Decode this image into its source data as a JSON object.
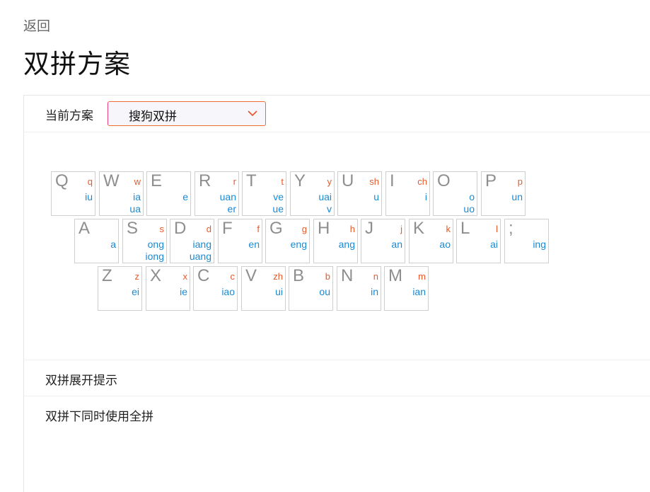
{
  "header": {
    "back_label": "返回",
    "title": "双拼方案"
  },
  "scheme": {
    "label": "当前方案",
    "selected": "搜狗双拼"
  },
  "keyboard": {
    "rows": [
      [
        {
          "letter": "Q",
          "initial": "q",
          "finals": [
            "iu"
          ]
        },
        {
          "letter": "W",
          "initial": "w",
          "finals": [
            "ia",
            "ua"
          ]
        },
        {
          "letter": "E",
          "initial": "",
          "finals": [
            "e"
          ]
        },
        {
          "letter": "R",
          "initial": "r",
          "finals": [
            "uan",
            "er"
          ]
        },
        {
          "letter": "T",
          "initial": "t",
          "finals": [
            "ve",
            "ue"
          ]
        },
        {
          "letter": "Y",
          "initial": "y",
          "finals": [
            "uai",
            "v"
          ]
        },
        {
          "letter": "U",
          "initial": "sh",
          "finals": [
            "u"
          ]
        },
        {
          "letter": "I",
          "initial": "ch",
          "finals": [
            "i"
          ]
        },
        {
          "letter": "O",
          "initial": "",
          "finals": [
            "o",
            "uo"
          ]
        },
        {
          "letter": "P",
          "initial": "p",
          "finals": [
            "un"
          ]
        }
      ],
      [
        {
          "letter": "A",
          "initial": "",
          "finals": [
            "a"
          ]
        },
        {
          "letter": "S",
          "initial": "s",
          "finals": [
            "ong",
            "iong"
          ]
        },
        {
          "letter": "D",
          "initial": "d",
          "finals": [
            "iang",
            "uang"
          ]
        },
        {
          "letter": "F",
          "initial": "f",
          "finals": [
            "en"
          ]
        },
        {
          "letter": "G",
          "initial": "g",
          "finals": [
            "eng"
          ]
        },
        {
          "letter": "H",
          "initial": "h",
          "finals": [
            "ang"
          ]
        },
        {
          "letter": "J",
          "initial": "j",
          "finals": [
            "an"
          ]
        },
        {
          "letter": "K",
          "initial": "k",
          "finals": [
            "ao"
          ]
        },
        {
          "letter": "L",
          "initial": "l",
          "finals": [
            "ai"
          ]
        },
        {
          "letter": ";",
          "initial": "",
          "finals": [
            "ing"
          ]
        }
      ],
      [
        {
          "letter": "Z",
          "initial": "z",
          "finals": [
            "ei"
          ]
        },
        {
          "letter": "X",
          "initial": "x",
          "finals": [
            "ie"
          ]
        },
        {
          "letter": "C",
          "initial": "c",
          "finals": [
            "iao"
          ]
        },
        {
          "letter": "V",
          "initial": "zh",
          "finals": [
            "ui"
          ]
        },
        {
          "letter": "B",
          "initial": "b",
          "finals": [
            "ou"
          ]
        },
        {
          "letter": "N",
          "initial": "n",
          "finals": [
            "in"
          ]
        },
        {
          "letter": "M",
          "initial": "m",
          "finals": [
            "ian"
          ]
        }
      ]
    ]
  },
  "options": [
    {
      "label": "双拼展开提示"
    },
    {
      "label": "双拼下同时使用全拼"
    }
  ],
  "colors": {
    "initial": "#e85a2a",
    "final": "#1a8ad4",
    "letter": "#8e8e8e",
    "select_border": "#f06a33"
  }
}
